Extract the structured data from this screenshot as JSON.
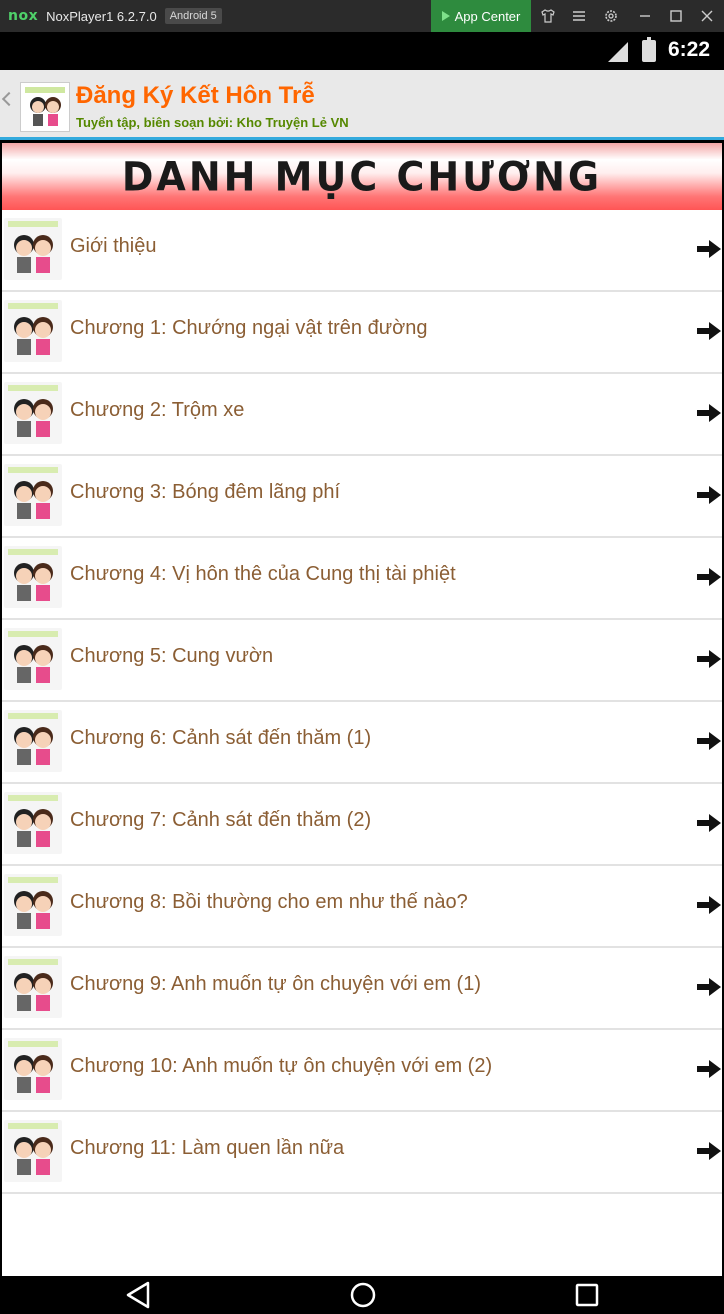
{
  "window": {
    "logo_text": "nox",
    "title": "NoxPlayer1 6.2.7.0",
    "android_badge": "Android 5",
    "app_center_label": "App Center",
    "controls": [
      "shirt-icon",
      "menu-icon",
      "gear-icon",
      "minimize-icon",
      "maximize-icon",
      "close-icon"
    ]
  },
  "status_bar": {
    "time": "6:22"
  },
  "header": {
    "title": "Đăng Ký Kết Hôn Trễ",
    "subtitle": "Tuyển tập, biên soạn bởi: Kho Truyện Lẻ VN"
  },
  "banner": {
    "text": "DANH MỤC CHƯƠNG"
  },
  "chapters": [
    {
      "label": "Giới thiệu"
    },
    {
      "label": "Chương 1: Chướng ngại vật trên đường"
    },
    {
      "label": "Chương 2: Trộm xe"
    },
    {
      "label": "Chương 3: Bóng đêm lãng phí"
    },
    {
      "label": "Chương 4: Vị hôn thê của Cung thị tài phiệt"
    },
    {
      "label": "Chương 5: Cung vườn"
    },
    {
      "label": "Chương 6: Cảnh sát đến thăm (1)"
    },
    {
      "label": "Chương 7: Cảnh sát đến thăm (2)"
    },
    {
      "label": "Chương 8: Bồi thường cho em như thế nào?"
    },
    {
      "label": "Chương 9: Anh muốn tự ôn chuyện với em (1)"
    },
    {
      "label": "Chương 10: Anh muốn tự ôn chuyện với em (2)"
    },
    {
      "label": "Chương 11: Làm quen lần nữa"
    }
  ],
  "colors": {
    "header_title": "#ff6600",
    "header_subtitle": "#558800",
    "chapter_text": "#8b5e34",
    "app_center": "#2e8b3e"
  }
}
